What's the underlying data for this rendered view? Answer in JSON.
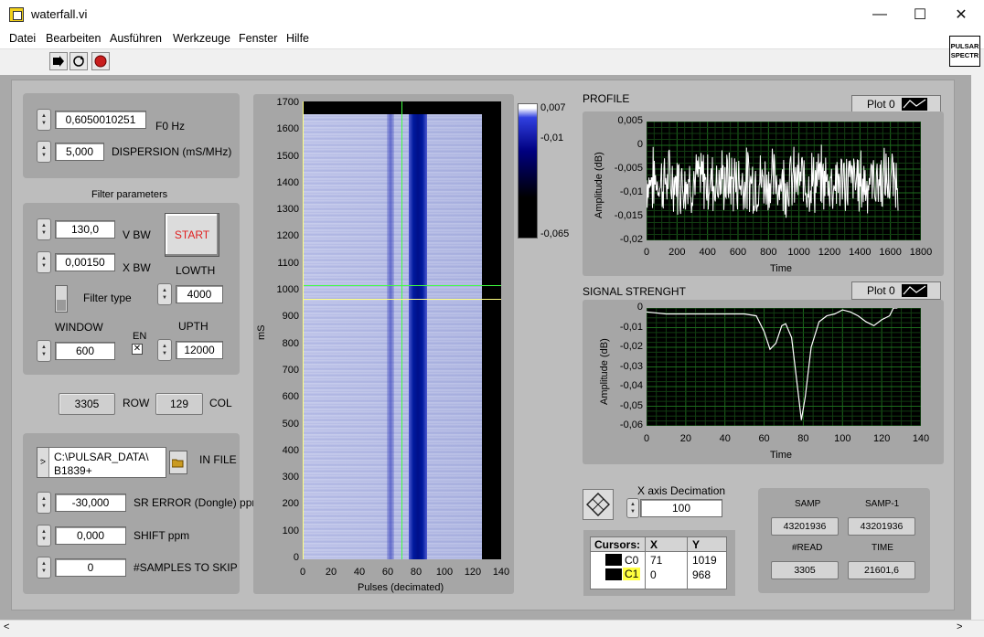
{
  "window": {
    "title": "waterfall.vi",
    "minimize": "—",
    "maximize": "☐",
    "close": "✕"
  },
  "menu": [
    "Datei",
    "Bearbeiten",
    "Ausführen",
    "Werkzeuge",
    "Fenster",
    "Hilfe"
  ],
  "vi_icon": {
    "line1": "PULSAR",
    "line2": "SPECTR"
  },
  "controls": {
    "f0": {
      "value": "0,6050010251",
      "label": "F0 Hz"
    },
    "dispersion": {
      "value": "5,000",
      "label": "DISPERSION (mS/MHz)"
    },
    "filter_title": "Filter parameters",
    "vbw": {
      "value": "130,0",
      "label": "V BW"
    },
    "xbw": {
      "value": "0,00150",
      "label": "X BW"
    },
    "start": "START",
    "lowth": {
      "value": "4000",
      "label": "LOWTH"
    },
    "filter_type": "Filter type",
    "window": {
      "value": "600",
      "label": "WINDOW"
    },
    "en": "EN",
    "upth": {
      "value": "12000",
      "label": "UPTH"
    },
    "row": {
      "value": "3305",
      "label": "ROW"
    },
    "col": {
      "value": "129",
      "label": "COL"
    },
    "in_file": {
      "line1": "C:\\PULSAR_DATA\\",
      "line2": "B1839+",
      "label": "IN FILE"
    },
    "sr_error": {
      "value": "-30,000",
      "label": "SR ERROR (Dongle) ppm"
    },
    "shift": {
      "value": "0,000",
      "label": "SHIFT ppm"
    },
    "skip": {
      "value": "0",
      "label": "#SAMPLES TO SKIP"
    }
  },
  "waterfall": {
    "y_label": "mS",
    "x_label": "Pulses (decimated)",
    "y_ticks": [
      "1700",
      "1600",
      "1500",
      "1400",
      "1300",
      "1200",
      "1100",
      "1000",
      "900",
      "800",
      "700",
      "600",
      "500",
      "400",
      "300",
      "200",
      "100",
      "0"
    ],
    "x_ticks": [
      "0",
      "20",
      "40",
      "60",
      "80",
      "100",
      "120",
      "140"
    ],
    "colorbar_ticks": [
      "0,007",
      "-0,01",
      "-0,065"
    ]
  },
  "profile": {
    "title": "PROFILE",
    "legend": "Plot 0",
    "y_label": "Amplitude (dB)",
    "x_label": "Time",
    "y_ticks": [
      "0,005",
      "0",
      "-0,005",
      "-0,01",
      "-0,015",
      "-0,02"
    ],
    "x_ticks": [
      "0",
      "200",
      "400",
      "600",
      "800",
      "1000",
      "1200",
      "1400",
      "1600",
      "1800"
    ]
  },
  "signal": {
    "title": "SIGNAL STRENGHT",
    "legend": "Plot 0",
    "y_label": "Amplitude (dB)",
    "x_label": "Time",
    "y_ticks": [
      "0",
      "-0,01",
      "-0,02",
      "-0,03",
      "-0,04",
      "-0,05",
      "-0,06"
    ],
    "x_ticks": [
      "0",
      "20",
      "40",
      "60",
      "80",
      "100",
      "120",
      "140"
    ]
  },
  "decimation": {
    "label": "X axis Decimation",
    "value": "100"
  },
  "cursors": {
    "headers": [
      "Cursors:",
      "X",
      "Y"
    ],
    "rows": [
      {
        "name": "C0",
        "x": "71",
        "y": "1019"
      },
      {
        "name": "C1",
        "x": "0",
        "y": "968"
      }
    ]
  },
  "stats": {
    "samp_label": "SAMP",
    "samp": "43201936",
    "samp1_label": "SAMP-1",
    "samp1": "43201936",
    "read_label": "#READ",
    "read": "3305",
    "time_label": "TIME",
    "time": "21601,6"
  },
  "colors": {
    "panel": "#bdbdbd",
    "group": "#a6a6a6",
    "plot_bg": "#000000",
    "grid": "#1d6b1d",
    "trace": "#ffffff",
    "cursor_green": "#40ff40",
    "cursor_yellow": "#ffff80",
    "pulse_band": "#001a9e"
  }
}
